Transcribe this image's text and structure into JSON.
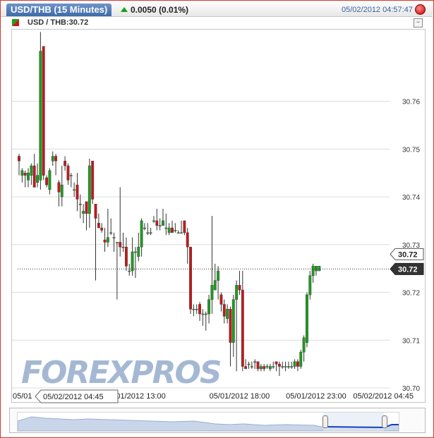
{
  "header": {
    "title": "USD/THB (15 Minutes)",
    "change": "0.0050 (0.01%)",
    "timestamp": "05/02/2012 04:57:47"
  },
  "legend": {
    "label": "USD / THB:30.72"
  },
  "watermark": "FOREXPROS",
  "colors": {
    "up": "#1aa01a",
    "down": "#c8171a",
    "grid": "#dcdcdc",
    "accent": "#3a5fa0"
  },
  "chart_data": {
    "type": "candlestick",
    "title": "USD/THB (15 Minutes)",
    "ylim": [
      30.7,
      30.775
    ],
    "yticks": [
      30.7,
      30.71,
      30.72,
      30.73,
      30.74,
      30.75,
      30.76
    ],
    "ytick_labels": [
      "30.70",
      "30.71",
      "30.72",
      "30.73",
      "30.74",
      "30.75",
      "30.76"
    ],
    "x_tick_labels": [
      "05/01",
      "05/01/2012 13:00",
      "05/01/2012 18:00",
      "05/01/2012 23:00",
      "05/02/2012 04:45"
    ],
    "x_tick_index": [
      0,
      38,
      72,
      97,
      127
    ],
    "hover_label": "05/02/2012 04:45",
    "last_price_label": "30.72",
    "last_close_label": "30.72",
    "last_price": 30.7249,
    "grid": true,
    "candles": [
      [
        30.7485,
        30.7475,
        30.749,
        30.7445
      ],
      [
        30.7445,
        30.7455,
        30.746,
        30.743
      ],
      [
        30.745,
        30.7445,
        30.7455,
        30.742
      ],
      [
        30.7435,
        30.745,
        30.746,
        30.742
      ],
      [
        30.7445,
        30.7465,
        30.747,
        30.7425
      ],
      [
        30.7465,
        30.742,
        30.749,
        30.742
      ],
      [
        30.743,
        30.7445,
        30.747,
        30.742
      ],
      [
        30.7435,
        30.7705,
        30.7745,
        30.7415
      ],
      [
        30.7715,
        30.7445,
        30.7715,
        30.7435
      ],
      [
        30.744,
        30.7425,
        30.7445,
        30.742
      ],
      [
        30.7415,
        30.7455,
        30.746,
        30.7405
      ],
      [
        30.7475,
        30.7485,
        30.7495,
        30.7465
      ],
      [
        30.7485,
        30.7475,
        30.749,
        30.7445
      ],
      [
        30.743,
        30.741,
        30.7435,
        30.738
      ],
      [
        30.74,
        30.7425,
        30.7465,
        30.738
      ],
      [
        30.7475,
        30.7465,
        30.7485,
        30.7455
      ],
      [
        30.7465,
        30.7435,
        30.747,
        30.7425
      ],
      [
        30.7445,
        30.7445,
        30.745,
        30.742
      ],
      [
        30.7415,
        30.7415,
        30.743,
        30.74
      ],
      [
        30.7425,
        30.7395,
        30.745,
        30.737
      ],
      [
        30.7385,
        30.7385,
        30.7405,
        30.7355
      ],
      [
        30.7365,
        30.737,
        30.7385,
        30.7345
      ],
      [
        30.739,
        30.7365,
        30.739,
        30.733
      ],
      [
        30.7365,
        30.7465,
        30.748,
        30.7335
      ],
      [
        30.7475,
        30.7395,
        30.7475,
        30.7385
      ],
      [
        30.7385,
        30.7355,
        30.7385,
        30.7225
      ],
      [
        30.7345,
        30.7335,
        30.7365,
        30.7335
      ],
      [
        30.7335,
        30.733,
        30.7345,
        30.7325
      ],
      [
        30.731,
        30.7305,
        30.7335,
        30.7285
      ],
      [
        30.7305,
        30.7315,
        30.7375,
        30.7295
      ],
      [
        30.7325,
        30.7325,
        30.7355,
        30.732
      ],
      [
        30.7315,
        30.7315,
        30.7325,
        30.7285
      ],
      [
        30.7305,
        30.7305,
        30.7305,
        30.7185
      ],
      [
        30.7305,
        30.7295,
        30.742,
        30.7275
      ],
      [
        30.7295,
        30.7295,
        30.7325,
        30.7285
      ],
      [
        30.7295,
        30.7255,
        30.7315,
        30.7245
      ],
      [
        30.7245,
        30.7245,
        30.726,
        30.7235
      ],
      [
        30.7245,
        30.7285,
        30.7315,
        30.7235
      ],
      [
        30.7285,
        30.7285,
        30.7295,
        30.723
      ],
      [
        30.7275,
        30.7295,
        30.7325,
        30.7265
      ],
      [
        30.7295,
        30.735,
        30.7355,
        30.7275
      ],
      [
        30.7335,
        30.7335,
        30.7345,
        30.733
      ],
      [
        30.7325,
        30.7325,
        30.7345,
        30.732
      ],
      [
        30.7325,
        30.7325,
        30.7335,
        30.732
      ],
      [
        30.735,
        30.735,
        30.736,
        30.7345
      ],
      [
        30.735,
        30.734,
        30.7375,
        30.733
      ],
      [
        30.734,
        30.734,
        30.7355,
        30.733
      ],
      [
        30.734,
        30.735,
        30.7375,
        30.734
      ],
      [
        30.7335,
        30.7335,
        30.7365,
        30.732
      ],
      [
        30.7325,
        30.7335,
        30.7345,
        30.732
      ],
      [
        30.7335,
        30.7325,
        30.735,
        30.7325
      ],
      [
        30.733,
        30.733,
        30.7345,
        30.7325
      ],
      [
        30.7325,
        30.7325,
        30.733,
        30.7325
      ],
      [
        30.7325,
        30.7325,
        30.735,
        30.7325
      ],
      [
        30.735,
        30.7325,
        30.735,
        30.732
      ],
      [
        30.7325,
        30.7295,
        30.7335,
        30.726
      ],
      [
        30.7295,
        30.7165,
        30.7295,
        30.7155
      ],
      [
        30.7165,
        30.7165,
        30.7175,
        30.715
      ],
      [
        30.7165,
        30.7165,
        30.7175,
        30.7155
      ],
      [
        30.7175,
        30.7155,
        30.718,
        30.714
      ],
      [
        30.7155,
        30.7155,
        30.7165,
        30.713
      ],
      [
        30.7155,
        30.7155,
        30.716,
        30.712
      ],
      [
        30.7155,
        30.7185,
        30.7195,
        30.7135
      ],
      [
        30.7185,
        30.7215,
        30.736,
        30.7155
      ],
      [
        30.7205,
        30.7225,
        30.726,
        30.7205
      ],
      [
        30.7225,
        30.7245,
        30.7255,
        30.7185
      ],
      [
        30.7195,
        30.7175,
        30.72,
        30.716
      ],
      [
        30.7175,
        30.715,
        30.7185,
        30.7135
      ],
      [
        30.7145,
        30.7165,
        30.7175,
        30.7135
      ],
      [
        30.7165,
        30.7095,
        30.717,
        30.7045
      ],
      [
        30.7095,
        30.7185,
        30.7195,
        30.7065
      ],
      [
        30.7185,
        30.7215,
        30.7225,
        30.7035
      ],
      [
        30.7215,
        30.7205,
        30.7245,
        30.7195
      ],
      [
        30.7205,
        30.7045,
        30.7245,
        30.7035
      ],
      [
        30.7045,
        30.704,
        30.706,
        30.704
      ],
      [
        30.705,
        30.705,
        30.7055,
        30.704
      ],
      [
        30.7045,
        30.7045,
        30.7055,
        30.704
      ],
      [
        30.7055,
        30.7055,
        30.706,
        30.704
      ],
      [
        30.7055,
        30.704,
        30.7055,
        30.7035
      ],
      [
        30.704,
        30.7045,
        30.705,
        30.7035
      ],
      [
        30.7045,
        30.704,
        30.705,
        30.7035
      ],
      [
        30.7045,
        30.7045,
        30.705,
        30.704
      ],
      [
        30.704,
        30.7045,
        30.705,
        30.7035
      ],
      [
        30.7045,
        30.7045,
        30.7055,
        30.704
      ],
      [
        30.7055,
        30.705,
        30.7055,
        30.7035
      ],
      [
        30.705,
        30.7045,
        30.7055,
        30.7025
      ],
      [
        30.7045,
        30.7045,
        30.7055,
        30.704
      ],
      [
        30.7045,
        30.7045,
        30.7055,
        30.7035
      ],
      [
        30.7045,
        30.7045,
        30.7055,
        30.704
      ],
      [
        30.7045,
        30.7045,
        30.7055,
        30.704
      ],
      [
        30.7045,
        30.7055,
        30.706,
        30.704
      ],
      [
        30.7055,
        30.7045,
        30.706,
        30.7035
      ],
      [
        30.7045,
        30.7075,
        30.708,
        30.704
      ],
      [
        30.7075,
        30.7105,
        30.711,
        30.7055
      ],
      [
        30.7095,
        30.7195,
        30.72,
        30.7085
      ],
      [
        30.7195,
        30.7235,
        30.7245,
        30.7185
      ],
      [
        30.7235,
        30.7255,
        30.726,
        30.722
      ],
      [
        30.7245,
        30.7255,
        30.7255,
        30.7235
      ],
      [
        30.7245,
        30.7255,
        30.7255,
        30.7245
      ]
    ]
  }
}
